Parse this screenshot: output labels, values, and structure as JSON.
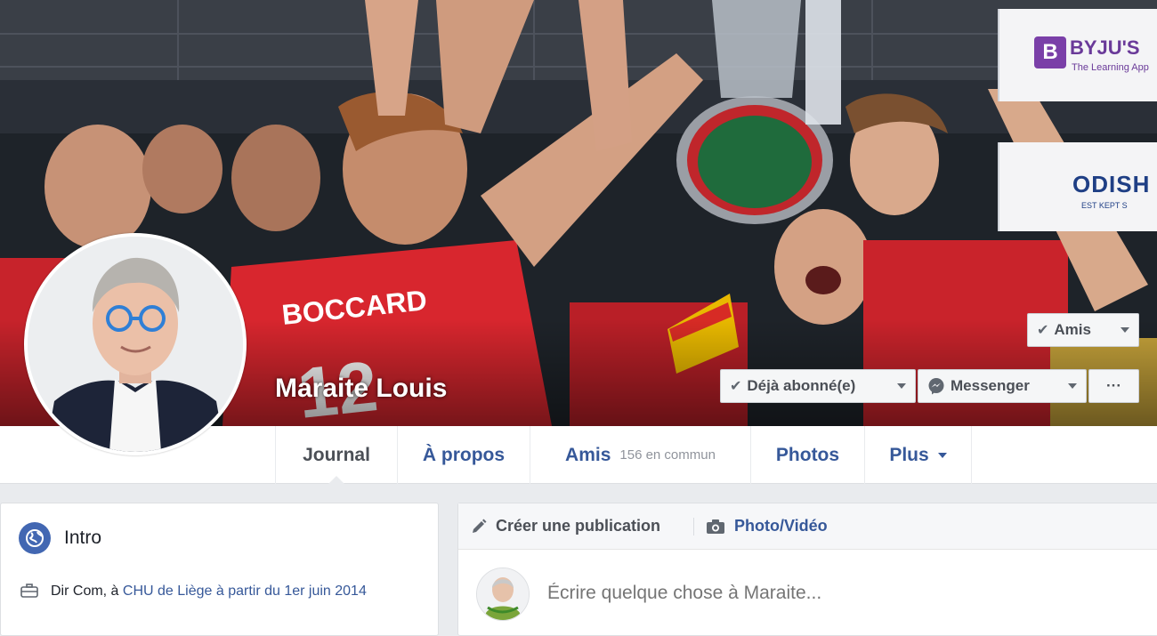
{
  "profile": {
    "name": "Maraite Louis"
  },
  "cover": {
    "sponsors": {
      "byjus_name": "BYJU'S",
      "byjus_tagline": "The Learning App",
      "odisha_name": "ODISH",
      "odisha_tagline": "EST KEPT S"
    },
    "player_jersey_name": "BOCCARD",
    "player_jersey_number": "12"
  },
  "actions": {
    "friends_label": "Amis",
    "following_label": "Déjà abonné(e)",
    "messenger_label": "Messenger",
    "more_label": "···"
  },
  "nav": {
    "tabs": [
      {
        "label": "Journal",
        "active": true
      },
      {
        "label": "À propos"
      },
      {
        "label": "Amis",
        "sub": "156 en commun"
      },
      {
        "label": "Photos"
      },
      {
        "label": "Plus"
      }
    ]
  },
  "intro": {
    "title": "Intro",
    "job_prefix": "Dir Com, à ",
    "job_link": "CHU de Liège à partir du 1er juin 2014"
  },
  "composer": {
    "create_post_label": "Créer une publication",
    "photo_video_label": "Photo/Vidéo",
    "placeholder": "Écrire quelque chose à Maraite..."
  },
  "colors": {
    "link_blue": "#365899",
    "brand_blue": "#4267b2",
    "jersey_red": "#d8262e",
    "page_bg": "#e9ebee"
  },
  "icons": [
    "check-icon",
    "caret-icon",
    "messenger-icon",
    "globe-icon",
    "briefcase-icon",
    "pencil-icon",
    "camera-icon"
  ]
}
